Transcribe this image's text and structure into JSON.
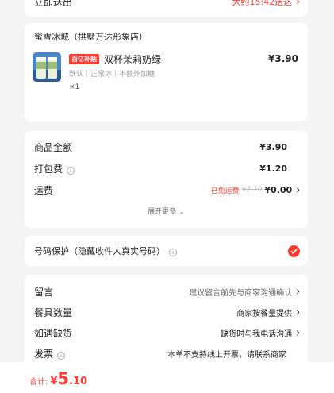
{
  "top_row": {
    "label": "立即送出",
    "value": "大约15:42送达"
  },
  "shop": {
    "name": "蜜雪冰城（拱墅万达形象店）"
  },
  "product": {
    "badge": "百亿补贴",
    "name": "双杯茉莉奶绿",
    "price": "¥3.90",
    "spec": "默认｜正常冰｜不额外加糖",
    "qty": "×1"
  },
  "fees": {
    "goods_label": "商品金额",
    "goods_value": "¥3.90",
    "pack_label": "打包费",
    "pack_value": "¥1.20",
    "ship_label": "运费",
    "ship_free": "已免运费",
    "ship_original": "¥2.70",
    "ship_value": "¥0.00",
    "expand": "展开更多"
  },
  "privacy": {
    "label": "号码保护（隐藏收件人真实号码）"
  },
  "options": [
    {
      "label": "留言",
      "value": "建议留言前先与商家沟通确认"
    },
    {
      "label": "餐具数量",
      "value": "商家按餐量提供"
    },
    {
      "label": "如遇缺货",
      "value": "缺货时与我电话沟通"
    },
    {
      "label": "发票",
      "value": "本单不支持线上开票，请联系商家"
    }
  ],
  "total": {
    "label": "合计:",
    "currency": "¥",
    "int": "5",
    "dec": ".10"
  },
  "colors": {
    "accent": "#ff3b2f",
    "background": "#f4f4f4"
  }
}
